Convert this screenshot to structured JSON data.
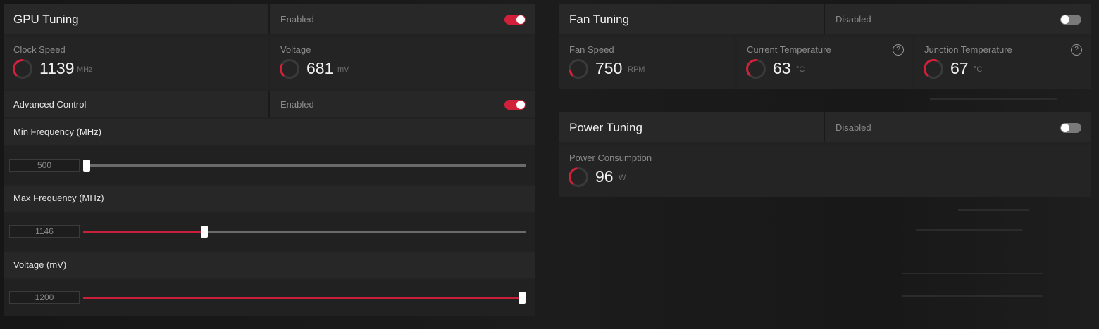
{
  "gpu_tuning": {
    "title": "GPU Tuning",
    "status": "Enabled",
    "enabled": true,
    "clock_speed": {
      "label": "Clock Speed",
      "value": "1139",
      "unit": "MHz"
    },
    "voltage": {
      "label": "Voltage",
      "value": "681",
      "unit": "mV"
    },
    "advanced_control": {
      "label": "Advanced Control",
      "status": "Enabled",
      "enabled": true
    },
    "min_frequency": {
      "label": "Min Frequency (MHz)",
      "value": "500",
      "fraction": 0.0
    },
    "max_frequency": {
      "label": "Max Frequency (MHz)",
      "value": "1146",
      "fraction": 0.27
    },
    "voltage_slider": {
      "label": "Voltage (mV)",
      "value": "1200",
      "fraction": 1.0
    }
  },
  "fan_tuning": {
    "title": "Fan Tuning",
    "status": "Disabled",
    "enabled": false,
    "fan_speed": {
      "label": "Fan Speed",
      "value": "750",
      "unit": "RPM"
    },
    "current_temperature": {
      "label": "Current Temperature",
      "value": "63",
      "unit": "°C"
    },
    "junction_temperature": {
      "label": "Junction Temperature",
      "value": "67",
      "unit": "°C"
    },
    "help_glyph": "?"
  },
  "power_tuning": {
    "title": "Power Tuning",
    "status": "Disabled",
    "enabled": false,
    "power_consumption": {
      "label": "Power Consumption",
      "value": "96",
      "unit": "W"
    }
  },
  "colors": {
    "accent": "#d3203a",
    "panel": "#222222",
    "header": "#282828",
    "text_dim": "#8a8a8a"
  },
  "icons": {
    "gauge": "gauge-icon",
    "help": "help-icon",
    "toggle": "toggle-switch"
  }
}
